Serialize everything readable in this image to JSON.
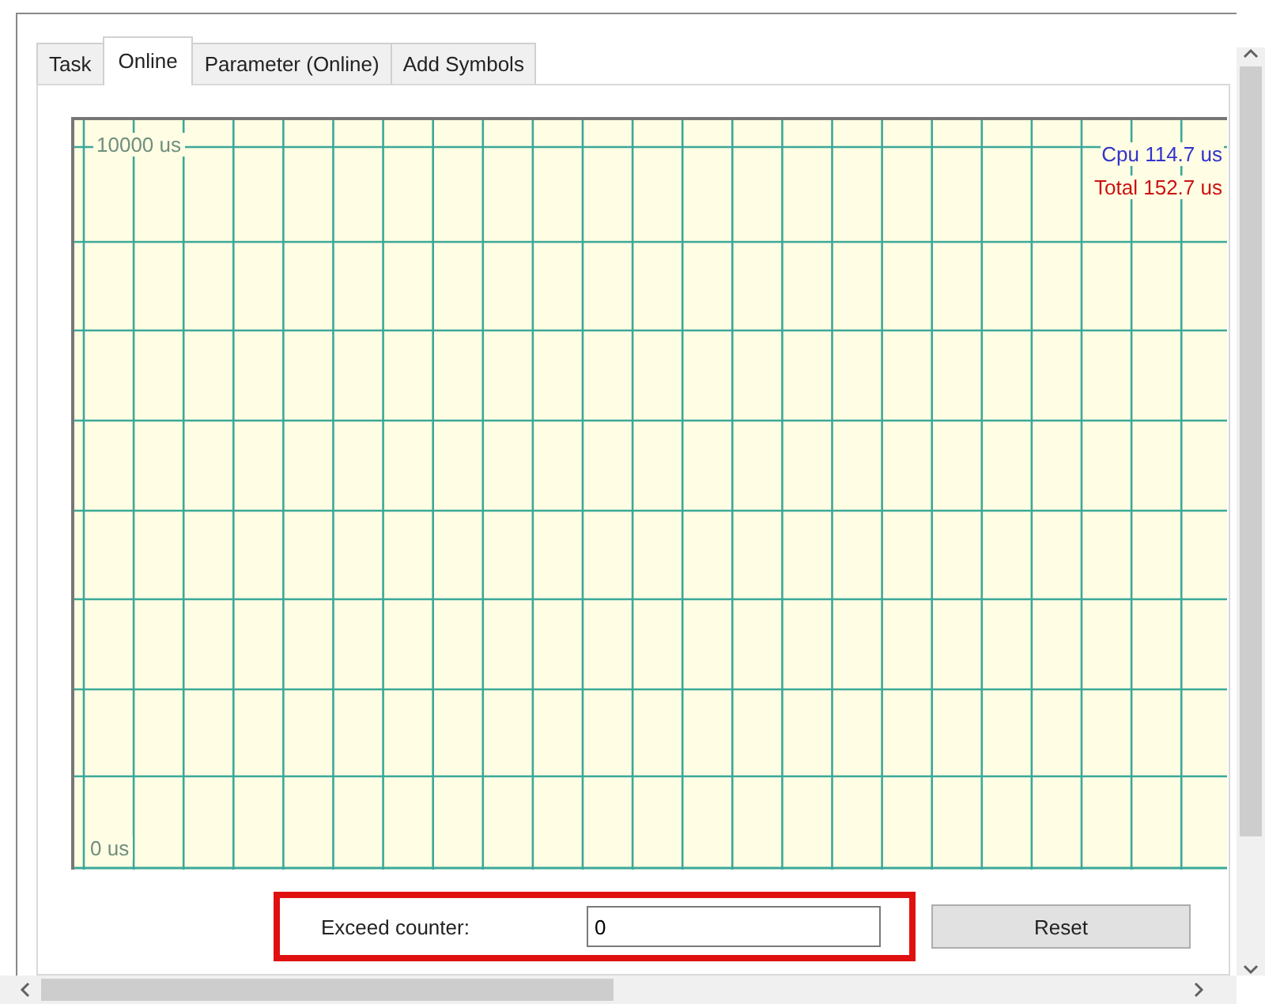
{
  "tabs": [
    {
      "label": "Task",
      "selected": false
    },
    {
      "label": "Online",
      "selected": true
    },
    {
      "label": "Parameter (Online)",
      "selected": false
    },
    {
      "label": "Add Symbols",
      "selected": false
    }
  ],
  "chart": {
    "y_max_label": "10000 us",
    "y_min_label": "0 us",
    "readings": [
      {
        "label": "Cpu 114.7 us",
        "color": "#3333cc"
      },
      {
        "label": "Total 152.7 us",
        "color": "#cc1111"
      }
    ]
  },
  "exceed_counter": {
    "label": "Exceed counter:",
    "value": "0",
    "highlighted": true
  },
  "buttons": [
    "Reset"
  ]
}
